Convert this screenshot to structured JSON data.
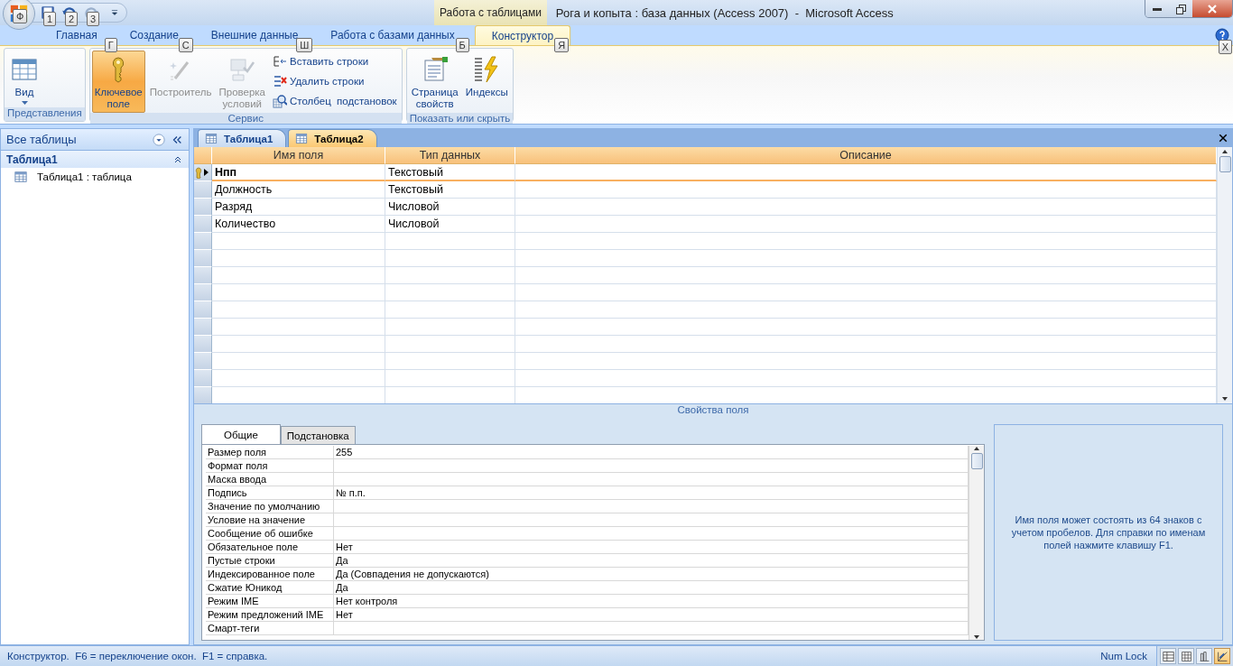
{
  "window": {
    "title": "Рога и копыта : база данных (Access 2007)  -  Microsoft Access",
    "context_tab": "Работа с таблицами"
  },
  "office_button": {
    "keytip": "Ф"
  },
  "quick_access": [
    {
      "keytip": "1"
    },
    {
      "keytip": "2"
    },
    {
      "keytip": "3"
    }
  ],
  "ribbon_tabs": [
    {
      "label": "Главная",
      "keytip": "Г",
      "selected": false
    },
    {
      "label": "Создание",
      "keytip": "С",
      "selected": false
    },
    {
      "label": "Внешние данные",
      "keytip": "Ш",
      "selected": false
    },
    {
      "label": "Работа с базами данных",
      "keytip": "Б",
      "selected": false
    },
    {
      "label": "Конструктор",
      "keytip": "Я",
      "selected": true
    }
  ],
  "help_keytip": "X",
  "ribbon_groups": [
    {
      "label": "Представления",
      "buttons": [
        {
          "label": "Вид",
          "kind": "large",
          "dropdown": true,
          "selected": false,
          "disabled": false
        }
      ]
    },
    {
      "label": "Сервис",
      "buttons": [
        {
          "label": "Ключевое поле",
          "kind": "large",
          "selected": true,
          "disabled": false
        },
        {
          "label": "Построитель",
          "kind": "large",
          "selected": false,
          "disabled": true
        },
        {
          "label": "Проверка условий",
          "kind": "large",
          "selected": false,
          "disabled": true
        },
        {
          "label": "Вставить строки",
          "kind": "small",
          "selected": false,
          "disabled": false
        },
        {
          "label": "Удалить строки",
          "kind": "small",
          "selected": false,
          "disabled": false
        },
        {
          "label": "Столбец  подстановок",
          "kind": "small",
          "selected": false,
          "disabled": false
        }
      ]
    },
    {
      "label": "Показать или скрыть",
      "buttons": [
        {
          "label": "Страница свойств",
          "kind": "large",
          "selected": false,
          "disabled": false
        },
        {
          "label": "Индексы",
          "kind": "large",
          "selected": false,
          "disabled": false
        }
      ]
    }
  ],
  "navigation_pane": {
    "header": "Все таблицы",
    "group": "Таблица1",
    "items": [
      {
        "label": "Таблица1 : таблица"
      }
    ]
  },
  "document_tabs": [
    {
      "label": "Таблица1",
      "selected": false
    },
    {
      "label": "Таблица2",
      "selected": true
    }
  ],
  "design_grid": {
    "columns": [
      "Имя поля",
      "Тип данных",
      "Описание"
    ],
    "rows": [
      {
        "field": "Нпп",
        "type": "Текстовый",
        "primary_key": true,
        "selected": true
      },
      {
        "field": "Должность",
        "type": "Текстовый",
        "primary_key": false,
        "selected": false
      },
      {
        "field": "Разряд",
        "type": "Числовой",
        "primary_key": false,
        "selected": false
      },
      {
        "field": "Количество",
        "type": "Числовой",
        "primary_key": false,
        "selected": false
      }
    ]
  },
  "field_properties": {
    "title": "Свойства поля",
    "tabs": [
      {
        "label": "Общие",
        "selected": true
      },
      {
        "label": "Подстановка",
        "selected": false
      }
    ],
    "rows": [
      {
        "name": "Размер поля",
        "value": "255"
      },
      {
        "name": "Формат поля"
      },
      {
        "name": "Маска ввода"
      },
      {
        "name": "Подпись",
        "value": "№ п.п."
      },
      {
        "name": "Значение по умолчанию"
      },
      {
        "name": "Условие на значение"
      },
      {
        "name": "Сообщение об ошибке"
      },
      {
        "name": "Обязательное поле",
        "value": "Нет"
      },
      {
        "name": "Пустые строки",
        "value": "Да"
      },
      {
        "name": "Индексированное поле",
        "value": "Да (Совпадения не допускаются)"
      },
      {
        "name": "Сжатие Юникод",
        "value": "Да"
      },
      {
        "name": "Режим IME",
        "value": "Нет контроля"
      },
      {
        "name": "Режим предложений IME",
        "value": "Нет"
      },
      {
        "name": "Смарт-теги"
      }
    ],
    "help": "Имя поля может состоять из 64 знаков с учетом пробелов.  Для справки по именам полей нажмите клавишу F1."
  },
  "status_bar": {
    "text": "Конструктор.  F6 = переключение окон.  F1 = справка.",
    "indicator": "Num Lock",
    "views": [
      {
        "selected": false
      },
      {
        "selected": false
      },
      {
        "selected": false
      },
      {
        "selected": true
      }
    ]
  }
}
